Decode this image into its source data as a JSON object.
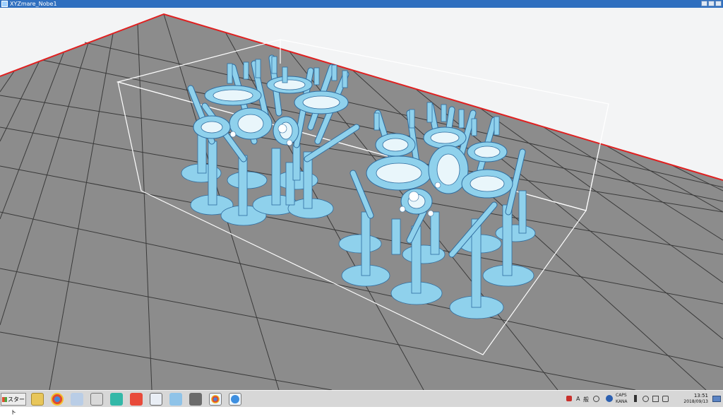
{
  "window": {
    "title": "XYZmare_Nobe1"
  },
  "taskbar": {
    "start_label": "スタート",
    "apps": [
      {
        "name": "explorer-icon"
      },
      {
        "name": "chrome-icon"
      },
      {
        "name": "recycle-icon"
      },
      {
        "name": "calculator-icon"
      },
      {
        "name": "printer-app-icon"
      },
      {
        "name": "paint-icon"
      },
      {
        "name": "window-app-icon"
      },
      {
        "name": "document-icon"
      },
      {
        "name": "tool-icon"
      },
      {
        "name": "chrome-icon"
      },
      {
        "name": "xyzware-icon"
      }
    ],
    "tray": {
      "lang": "A",
      "ime": "般",
      "caps": "CAPS",
      "kana": "KANA",
      "time": "13:51",
      "date": "2018/09/13"
    }
  },
  "scene": {
    "model_color": "#8fd1ec",
    "edge_color": "#2f6da0",
    "platform_color": "#8c8c8c",
    "limit_line_color": "#e02020",
    "bbox_color": "#ffffff"
  }
}
